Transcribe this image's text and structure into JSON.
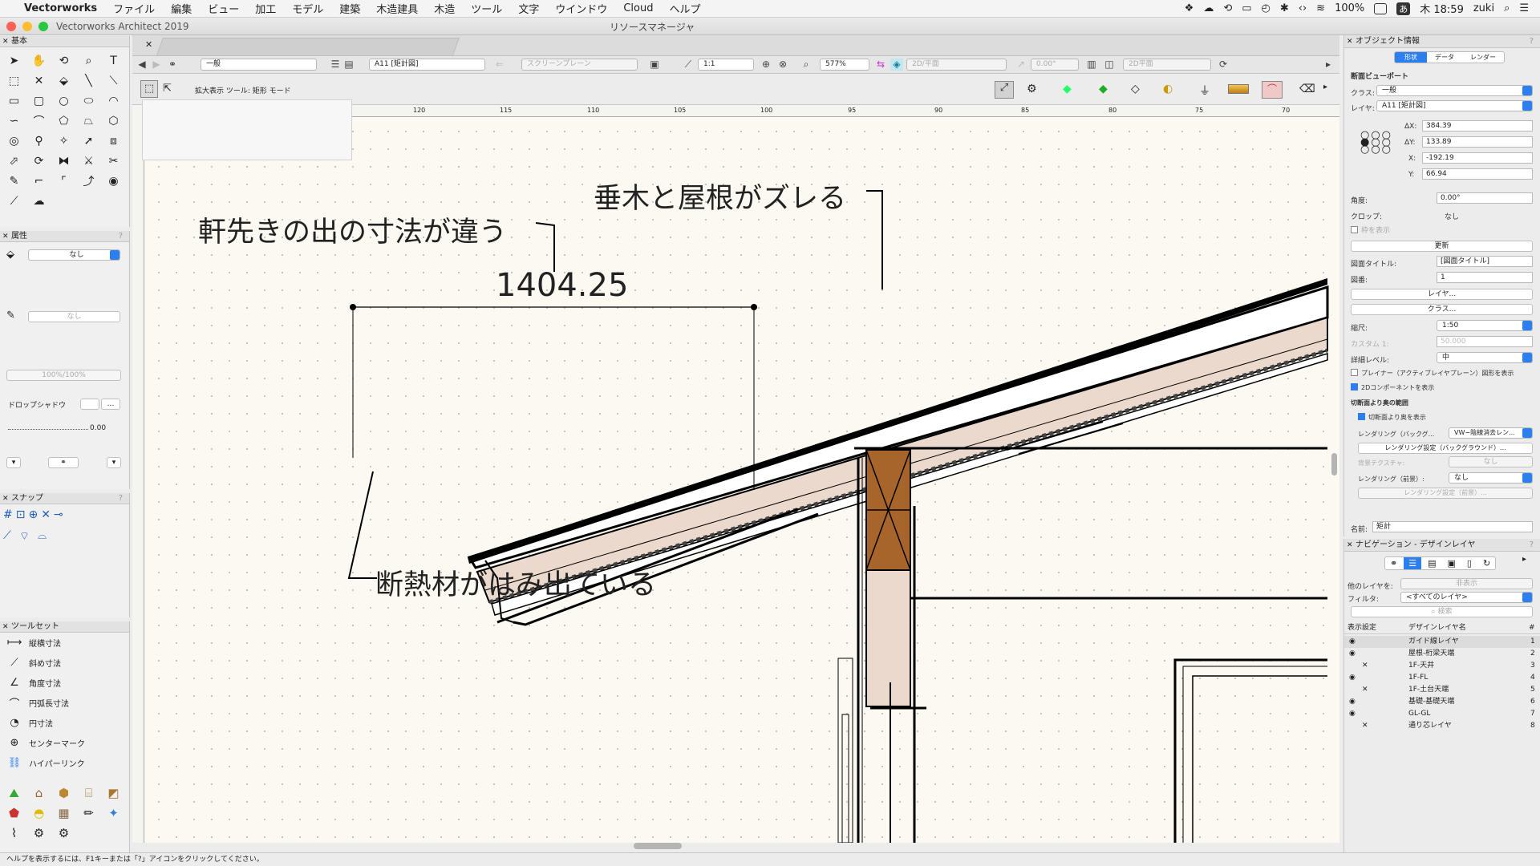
{
  "menubar": {
    "apple": "",
    "app": "Vectorworks",
    "items": [
      "ファイル",
      "編集",
      "ビュー",
      "加工",
      "モデル",
      "建築",
      "木造建具",
      "木造",
      "ツール",
      "文字",
      "ウインドウ",
      "Cloud",
      "ヘルプ"
    ],
    "right": {
      "battery": "100%",
      "clock": "木 18:59",
      "user": "zuki"
    }
  },
  "window": {
    "title": "Vectorworks Architect 2019",
    "resource_manager": "リソースマネージャ"
  },
  "palettes": {
    "basic": {
      "title": "基本"
    },
    "attributes": {
      "title": "属性",
      "fill": "なし",
      "pen": "なし",
      "opacity": "100%/100%",
      "drop_shadow": "ドロップシャドウ",
      "line_weight": "0.00"
    },
    "snap": {
      "title": "スナップ"
    },
    "toolset": {
      "title": "ツールセット",
      "items": [
        "縦横寸法",
        "斜め寸法",
        "角度寸法",
        "円弧長寸法",
        "円寸法",
        "センターマーク",
        "ハイパーリンク"
      ]
    }
  },
  "toolbar": {
    "class": "一般",
    "layer": "A11 [矩計図]",
    "plane": "スクリーンプレーン",
    "scale": "1:1",
    "zoom": "577%",
    "view": "2D/平面",
    "angle": "0.00°",
    "render": "2D平面"
  },
  "modebar": {
    "label": "拡大表示 ツール: 矩形 モード"
  },
  "canvas": {
    "ruler_marks": [
      "120",
      "115",
      "110",
      "105",
      "100",
      "95",
      "90",
      "85",
      "80",
      "75",
      "70"
    ],
    "annotation_rafter": "垂木と屋根がズレる",
    "annotation_eave": "軒先きの出の寸法が違う",
    "dimension": "1404.25",
    "annotation_insulation": "断熱材がはみ出ている"
  },
  "obj_info": {
    "title": "オブジェクト情報",
    "tabs": [
      "形状",
      "データ",
      "レンダー"
    ],
    "section_title": "断面ビューポート",
    "class_label": "クラス:",
    "class_value": "一般",
    "layer_label": "レイヤ:",
    "layer_value": "A11 [矩計図]",
    "dx_label": "ΔX:",
    "dx": "384.39",
    "dy_label": "ΔY:",
    "dy": "133.89",
    "x_label": "X:",
    "x": "-192.19",
    "y_label": "Y:",
    "y": "66.94",
    "angle_label": "角度:",
    "angle": "0.00°",
    "crop_label": "クロップ:",
    "crop": "なし",
    "show_crop": "枠を表示",
    "update": "更新",
    "drawing_title_label": "図面タイトル:",
    "drawing_title": "[図面タイトル]",
    "drawing_no_label": "図番:",
    "drawing_no": "1",
    "layer_btn": "レイヤ...",
    "class_btn": "クラス...",
    "scale_label": "縮尺:",
    "scale": "1:50",
    "custom_label": "カスタム 1:",
    "custom": "50.000",
    "detail_label": "詳細レベル:",
    "detail": "中",
    "planar_chk": "プレイナー（アクティブレイヤプレーン）図形を表示",
    "comp2d_chk": "2Dコンポーネントを表示",
    "beyond_section": "切断面より奥の範囲",
    "show_beyond": "切断面より奥を表示",
    "render_bg_label": "レンダリング（バックグ...",
    "render_bg": "VW−陰線消去レン...",
    "render_bg_btn": "レンダリング設定（バックグラウンド）...",
    "bg_texture_label": "背景テクスチャ:",
    "bg_texture": "なし",
    "render_fg_label": "レンダリング（前景）:",
    "render_fg": "なし",
    "render_fg_btn": "レンダリング設定（前景）...",
    "name_label": "名前:",
    "name": "矩計"
  },
  "navigation": {
    "title": "ナビゲーション - デザインレイヤ",
    "other_layers_label": "他のレイヤを:",
    "other_layers": "非表示",
    "filter_label": "フィルタ:",
    "filter": "<すべてのレイヤ>",
    "search_placeholder": "検索",
    "col_visibility": "表示設定",
    "col_name": "デザインレイヤ名",
    "col_num": "#",
    "layers": [
      {
        "name": "ガイド線レイヤ",
        "num": "1",
        "vis": "eye"
      },
      {
        "name": "屋根-桁梁天端",
        "num": "2",
        "vis": "eye"
      },
      {
        "name": "1F-天井",
        "num": "3",
        "vis": "x"
      },
      {
        "name": "1F-FL",
        "num": "4",
        "vis": "eye"
      },
      {
        "name": "1F-土台天端",
        "num": "5",
        "vis": "x"
      },
      {
        "name": "基礎-基礎天端",
        "num": "6",
        "vis": "eye"
      },
      {
        "name": "GL-GL",
        "num": "7",
        "vis": "eye"
      },
      {
        "name": "通り芯レイヤ",
        "num": "8",
        "vis": "x"
      }
    ]
  },
  "status": {
    "text": "ヘルプを表示するには、F1キーまたは「?」アイコンをクリックしてください。"
  },
  "colors": {
    "accent": "#2d7ff0",
    "canvas": "#fbf9f2",
    "roof_fill": "#ead9cc",
    "post_fill": "#a8652b"
  }
}
